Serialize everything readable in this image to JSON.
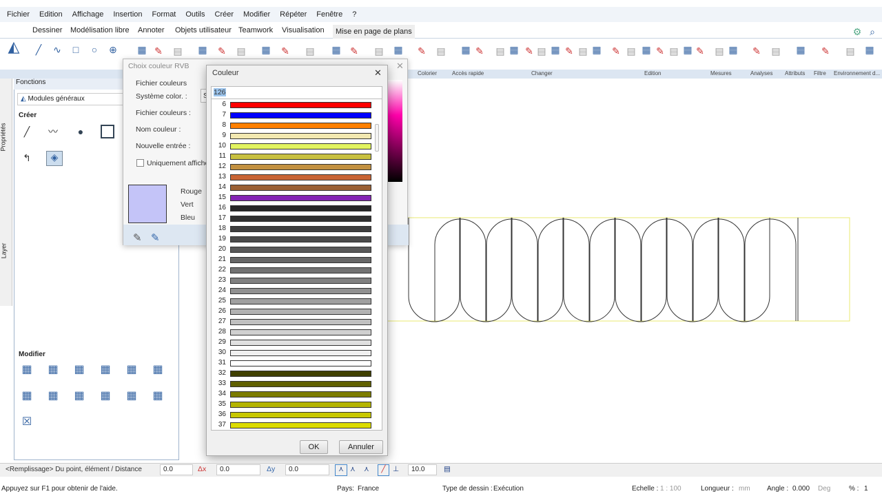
{
  "menu": [
    "Fichier",
    "Edition",
    "Affichage",
    "Insertion",
    "Format",
    "Outils",
    "Créer",
    "Modifier",
    "Répéter",
    "Fenêtre",
    "?"
  ],
  "tabs": [
    "Dessiner",
    "Modélisation libre",
    "Annoter",
    "Objets utilisateur",
    "Teamwork",
    "Visualisation",
    "Mise en page de plans"
  ],
  "active_tab": "Dessiner",
  "ribbon_groups": [
    "Colorier",
    "Accès rapide",
    "Changer",
    "Edition",
    "Mesures",
    "Analyses",
    "Attributs",
    "Filtre",
    "Environnement d..."
  ],
  "side_tabs": {
    "properties": "Propriétés",
    "layer": "Layer"
  },
  "functions": {
    "title": "Fonctions",
    "module": "Modules généraux",
    "create": "Créer",
    "modify": "Modifier"
  },
  "rvb_dialog": {
    "title": "Choix couleur RVB",
    "group": "Fichier couleurs",
    "system": "Système color. :",
    "system_value": "S",
    "file": "Fichier couleurs :",
    "name": "Nom couleur :",
    "new_entry": "Nouvelle entrée :",
    "only_show": "Uniquement afficher",
    "red": "Rouge",
    "green": "Vert",
    "blue": "Bleu",
    "preview_color": "#c4c4f8"
  },
  "color_dialog": {
    "title": "Couleur",
    "input_value": "126",
    "ok": "OK",
    "cancel": "Annuler",
    "colors": [
      {
        "n": "6",
        "c": "#ff0000"
      },
      {
        "n": "7",
        "c": "#0000ff"
      },
      {
        "n": "8",
        "c": "#ff8000"
      },
      {
        "n": "9",
        "c": "#f2e8b0"
      },
      {
        "n": "10",
        "c": "#e2f460"
      },
      {
        "n": "11",
        "c": "#c8c040"
      },
      {
        "n": "12",
        "c": "#c29040"
      },
      {
        "n": "13",
        "c": "#c86434"
      },
      {
        "n": "14",
        "c": "#9a6034"
      },
      {
        "n": "15",
        "c": "#8424b4"
      },
      {
        "n": "16",
        "c": "#262626"
      },
      {
        "n": "17",
        "c": "#303030"
      },
      {
        "n": "18",
        "c": "#3e3e3e"
      },
      {
        "n": "19",
        "c": "#4a4a4a"
      },
      {
        "n": "20",
        "c": "#585858"
      },
      {
        "n": "21",
        "c": "#666666"
      },
      {
        "n": "22",
        "c": "#727272"
      },
      {
        "n": "23",
        "c": "#808080"
      },
      {
        "n": "24",
        "c": "#909090"
      },
      {
        "n": "25",
        "c": "#a0a0a0"
      },
      {
        "n": "26",
        "c": "#b2b2b2"
      },
      {
        "n": "27",
        "c": "#c0c0c0"
      },
      {
        "n": "28",
        "c": "#d0d0d0"
      },
      {
        "n": "29",
        "c": "#e0e0e0"
      },
      {
        "n": "30",
        "c": "#f0f0f0"
      },
      {
        "n": "31",
        "c": "#ffffff"
      },
      {
        "n": "32",
        "c": "#404000"
      },
      {
        "n": "33",
        "c": "#606000"
      },
      {
        "n": "34",
        "c": "#7c7c00"
      },
      {
        "n": "35",
        "c": "#b4b400"
      },
      {
        "n": "36",
        "c": "#c8c800"
      },
      {
        "n": "37",
        "c": "#dcdc00"
      }
    ]
  },
  "command": {
    "prompt": "<Remplissage> Du point, élément / Distance",
    "v0": "0.0",
    "dx_label": "Δx",
    "dx": "0.0",
    "dy_label": "Δy",
    "dy": "0.0",
    "step": "10.0"
  },
  "status": {
    "help": "Appuyez sur F1 pour obtenir de l'aide.",
    "country_label": "Pays:",
    "country": "France",
    "type_label": "Type de dessin :",
    "type": "Exécution",
    "scale_label": "Echelle :",
    "scale": "1 : 100",
    "length_label": "Longueur :",
    "length": "mm",
    "angle_label": "Angle :",
    "angle": "0.000",
    "angle_unit": "Deg",
    "pct_label": "% :",
    "pct": "1"
  }
}
